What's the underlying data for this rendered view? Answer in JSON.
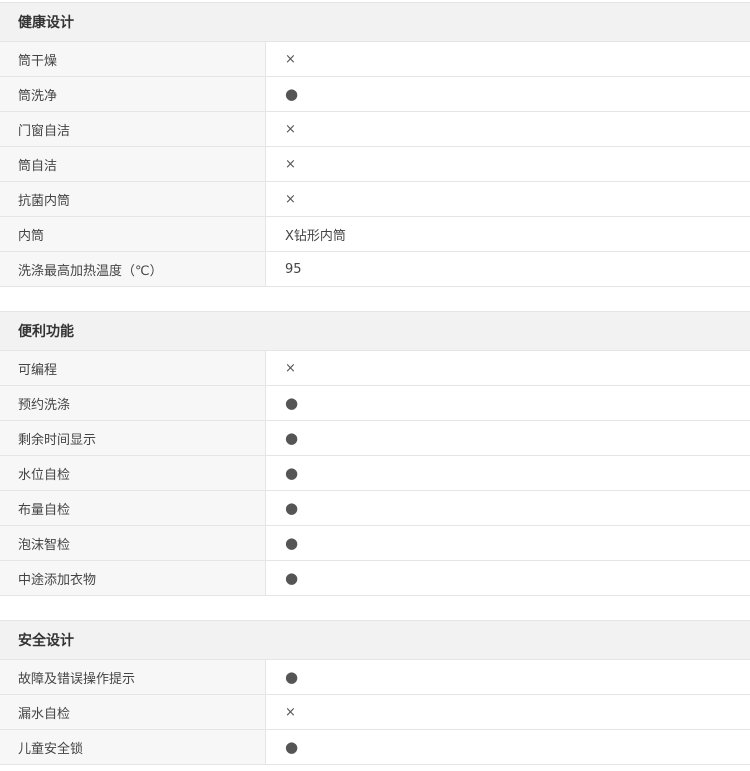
{
  "sections": [
    {
      "title": "健康设计",
      "rows": [
        {
          "label": "筒干燥",
          "value": "×"
        },
        {
          "label": "筒洗净",
          "value": "●"
        },
        {
          "label": "门窗自洁",
          "value": "×"
        },
        {
          "label": "筒自洁",
          "value": "×"
        },
        {
          "label": "抗菌内筒",
          "value": "×"
        },
        {
          "label": "内筒",
          "value": "X钻形内筒"
        },
        {
          "label": "洗涤最高加热温度（℃）",
          "value": "95"
        }
      ]
    },
    {
      "title": "便利功能",
      "rows": [
        {
          "label": "可编程",
          "value": "×"
        },
        {
          "label": "预约洗涤",
          "value": "●"
        },
        {
          "label": "剩余时间显示",
          "value": "●"
        },
        {
          "label": "水位自检",
          "value": "●"
        },
        {
          "label": "布量自检",
          "value": "●"
        },
        {
          "label": "泡沫智检",
          "value": "●"
        },
        {
          "label": "中途添加衣物",
          "value": "●"
        }
      ]
    },
    {
      "title": "安全设计",
      "rows": [
        {
          "label": "故障及错误操作提示",
          "value": "●"
        },
        {
          "label": "漏水自检",
          "value": "×"
        },
        {
          "label": "儿童安全锁",
          "value": "●"
        }
      ]
    }
  ]
}
